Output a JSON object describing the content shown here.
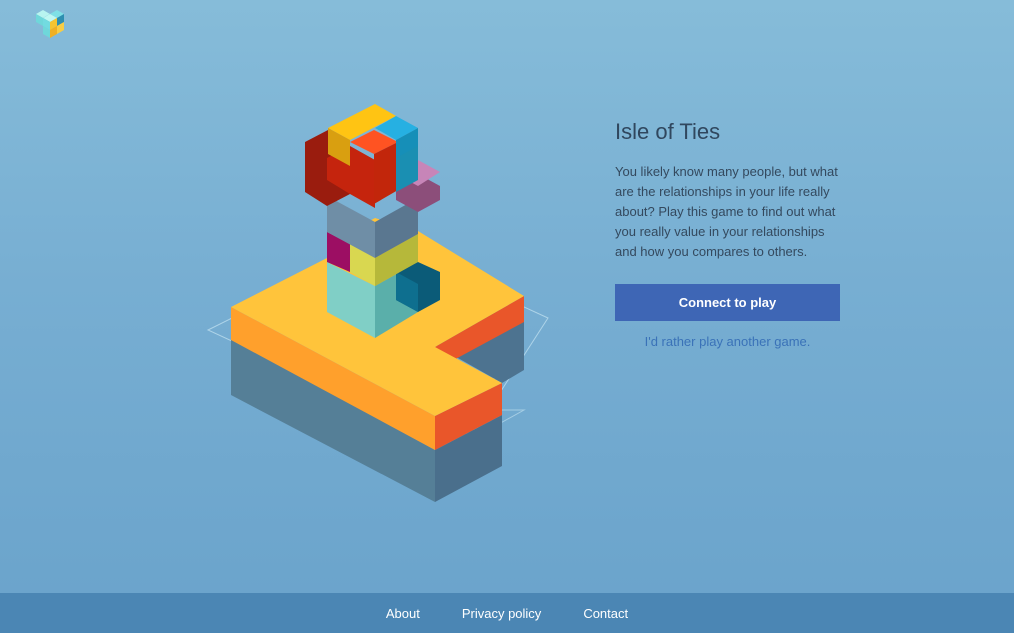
{
  "logo": {
    "icon": "tetris-cube-logo"
  },
  "game": {
    "title": "Isle of Ties",
    "description": "You likely know many people, but what are the relationships in your life really about? Play this game to find out what you really value in your relationships and how you compares to others.",
    "connect_label": "Connect to play",
    "alt_label": "I'd rather play another game."
  },
  "footer": {
    "links": [
      {
        "label": "About"
      },
      {
        "label": "Privacy policy"
      },
      {
        "label": "Contact"
      }
    ]
  },
  "colors": {
    "background": "#80b7d8",
    "button": "#3e66b5",
    "link": "#3a72b8",
    "footer": "#4b86b4",
    "island_top": "#ffc43b",
    "island_side": "#ff9f2e",
    "island_edge": "#e9562a"
  }
}
